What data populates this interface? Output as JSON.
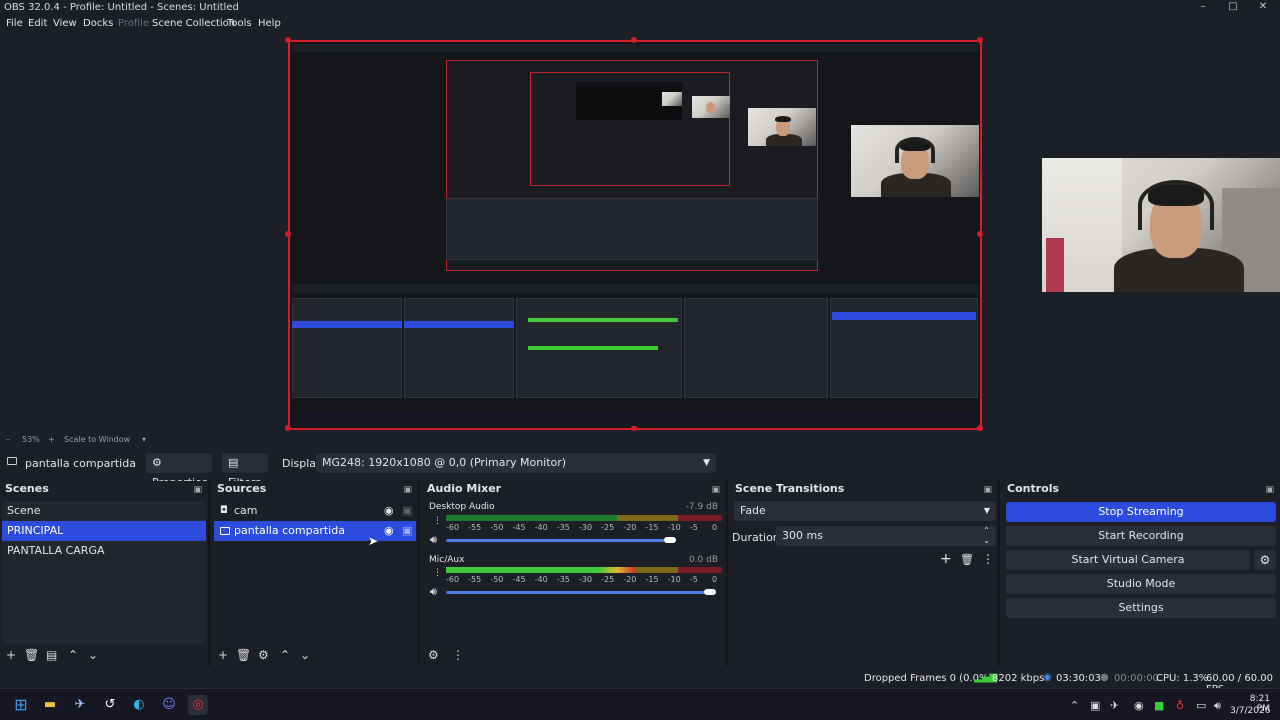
{
  "window": {
    "title": "OBS 32.0.4 - Profile: Untitled - Scenes: Untitled"
  },
  "menu": [
    "File",
    "Edit",
    "View",
    "Docks",
    "Profile",
    "Scene Collection",
    "Tools",
    "Help"
  ],
  "preview": {
    "zoom": "53%",
    "scale_mode": "Scale to Window"
  },
  "source_toolbar": {
    "selected_source": "pantalla compartida",
    "properties": "Properties",
    "filters": "Filters",
    "display_label": "Display",
    "display_value": "MG248: 1920x1080 @ 0,0 (Primary Monitor)"
  },
  "scenes": {
    "title": "Scenes",
    "items": [
      "Scene",
      "PRINCIPAL",
      "PANTALLA CARGA"
    ],
    "selected": "PRINCIPAL"
  },
  "sources": {
    "title": "Sources",
    "items": [
      {
        "name": "cam",
        "icon": "camera-icon"
      },
      {
        "name": "pantalla compartida",
        "icon": "monitor-icon"
      }
    ],
    "selected": "pantalla compartida"
  },
  "audio_mixer": {
    "title": "Audio Mixer",
    "ticks": [
      "-60",
      "-55",
      "-50",
      "-45",
      "-40",
      "-35",
      "-30",
      "-25",
      "-20",
      "-15",
      "-10",
      "-5",
      "0"
    ],
    "channels": [
      {
        "name": "Desktop Audio",
        "db": "-7.9 dB",
        "level": 0.0,
        "volume": 0.85
      },
      {
        "name": "Mic/Aux",
        "db": "0.0 dB",
        "level": 0.69,
        "volume": 1.0
      }
    ]
  },
  "transitions": {
    "title": "Scene Transitions",
    "selected": "Fade",
    "duration_label": "Duration",
    "duration": "300 ms"
  },
  "controls": {
    "title": "Controls",
    "stop_streaming": "Stop Streaming",
    "start_recording": "Start Recording",
    "start_virtual_camera": "Start Virtual Camera",
    "studio_mode": "Studio Mode",
    "settings": "Settings"
  },
  "status": {
    "dropped_frames": "Dropped Frames 0 (0.0%)",
    "bitrate": "8202 kbps",
    "stream_time": "03:30:03",
    "record_time": "00:00:00",
    "cpu": "CPU: 1.3%",
    "fps": "60.00 / 60.00 FPS"
  },
  "taskbar": {
    "time": "8:21 PM",
    "date": "3/7/2026"
  },
  "colors": {
    "accent": "#2d4bdc",
    "selection_border": "#d71d29",
    "background": "#1d1f26"
  }
}
